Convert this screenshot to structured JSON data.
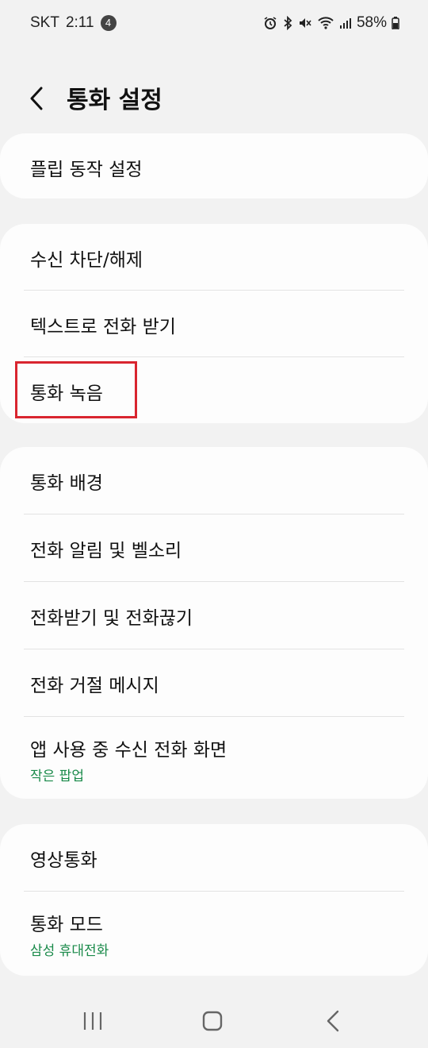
{
  "status_bar": {
    "carrier": "SKT",
    "time": "2:11",
    "notification_count": "4",
    "battery": "58%"
  },
  "header": {
    "title": "통화 설정"
  },
  "groups": [
    {
      "items": [
        {
          "label": "플립 동작 설정"
        }
      ]
    },
    {
      "items": [
        {
          "label": "수신 차단/해제"
        },
        {
          "label": "텍스트로 전화 받기"
        },
        {
          "label": "통화 녹음"
        }
      ]
    },
    {
      "items": [
        {
          "label": "통화 배경"
        },
        {
          "label": "전화 알림 및 벨소리"
        },
        {
          "label": "전화받기 및 전화끊기"
        },
        {
          "label": "전화 거절 메시지"
        },
        {
          "label": "앱 사용 중 수신 전화 화면",
          "sub": "작은 팝업"
        }
      ]
    },
    {
      "items": [
        {
          "label": "영상통화"
        },
        {
          "label": "통화 모드",
          "sub": "삼성 휴대전화"
        }
      ]
    }
  ],
  "colors": {
    "background": "#f2f2f2",
    "card": "#fdfdfd",
    "sub_text": "#1a8a4a",
    "highlight": "#d9252f"
  }
}
